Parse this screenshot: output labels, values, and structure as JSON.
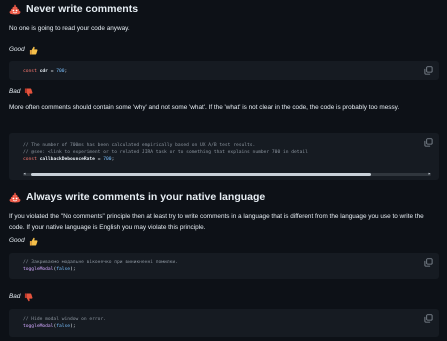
{
  "section1": {
    "title": "Never write comments",
    "intro": "No one is going to read your code anyway.",
    "good_label": "Good",
    "good_code": [
      {
        "kw": "const",
        "id": " cdr",
        "op": " = ",
        "num": "700",
        "end": ";"
      }
    ],
    "bad_label": "Bad",
    "bad_text": "More often comments should contain some 'why' and not some 'what'. If the 'what' is not clear in the code, the code is probably too messy.",
    "bad_code": {
      "comment1": "// The number of 700ms has been calculated empirically based on UX A/B test results.",
      "comment2": "// @see: <link to experiment or to related JIRA task or to something that explains number 700 in detail",
      "kw": "const",
      "id": " callbackDebounceRate",
      "op": " = ",
      "num": "700",
      "end": ";"
    }
  },
  "section2": {
    "title": "Always write comments in your native language",
    "intro": "If you violated the \"No comments\" principle then at least try to write comments in a language that is different from the language you use to write the code. If your native language is English you may violate this principle.",
    "good_label": "Good",
    "good_code": {
      "comment": "// Закриваємо модальне віконечко при виникненні помилки.",
      "fn": "toggleModal",
      "args_open": "(",
      "arg": "false",
      "args_close": ");"
    },
    "bad_label": "Bad",
    "bad_code": {
      "comment": "// Hide modal window on error.",
      "fn": "toggleModal",
      "args_open": "(",
      "arg": "false",
      "args_close": ");"
    }
  },
  "icons": {
    "heading": "poop-icon",
    "good": "thumbs-up-icon",
    "bad": "thumbs-down-icon",
    "copy": "copy-icon"
  },
  "colors": {
    "background": "#0d1117",
    "code_background": "#161b22",
    "keyword": "#ff7b72",
    "number": "#79c0ff",
    "comment": "#8b949e"
  }
}
